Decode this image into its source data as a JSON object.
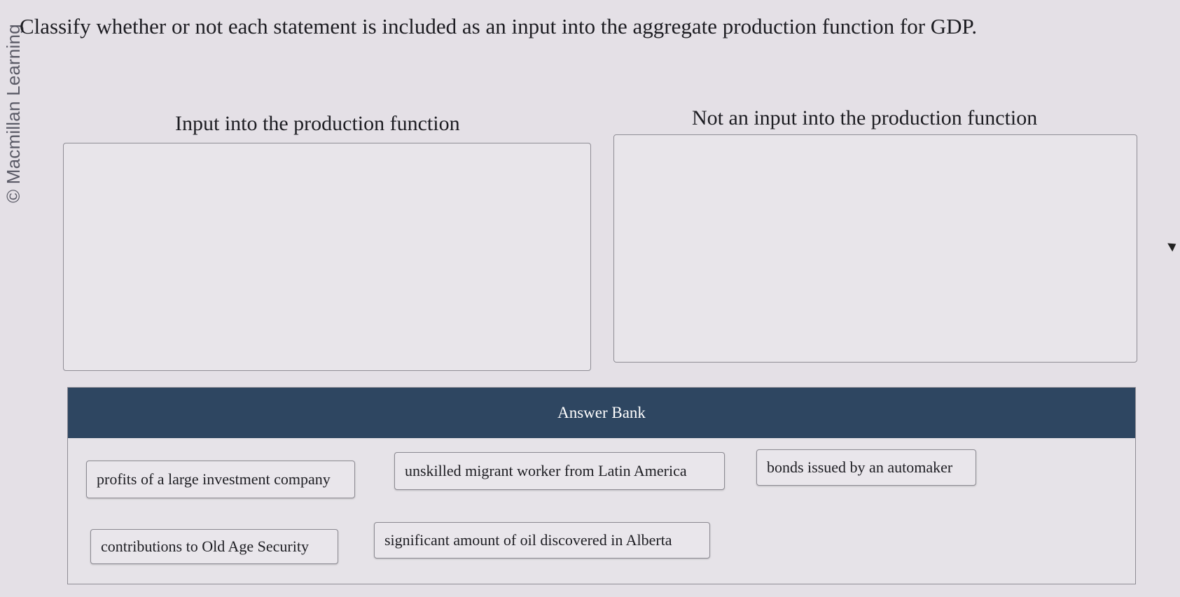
{
  "watermark": "© Macmillan Learning",
  "question": {
    "prompt": "Classify whether or not each statement is included as an input into the aggregate production function for GDP."
  },
  "categories": [
    {
      "label": "Input into the production function"
    },
    {
      "label": "Not an input into the production function"
    }
  ],
  "answer_bank": {
    "title": "Answer Bank",
    "items": [
      {
        "label": "profits of a large investment company"
      },
      {
        "label": "unskilled migrant worker from Latin America"
      },
      {
        "label": "bonds issued by an automaker"
      },
      {
        "label": "contributions to Old Age Security"
      },
      {
        "label": "significant amount of oil discovered in Alberta"
      }
    ]
  },
  "colors": {
    "header_bg": "#2e4661",
    "page_bg": "#e4e0e6"
  }
}
